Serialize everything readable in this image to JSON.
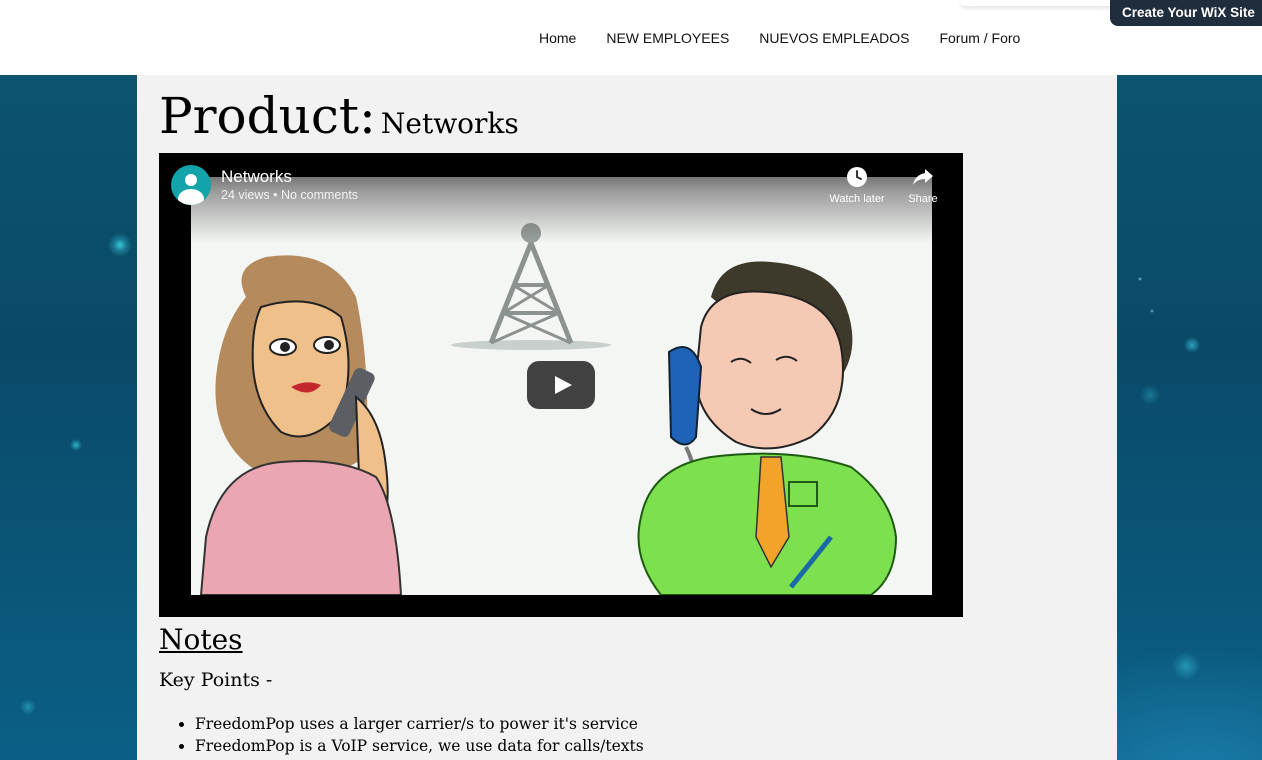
{
  "nav": {
    "items": [
      "Home",
      "NEW EMPLOYEES",
      "NUEVOS EMPLEADOS",
      "Forum / Foro"
    ]
  },
  "wix_banner": {
    "label": "Create Your WiX Site"
  },
  "page": {
    "title_prefix": "Product:",
    "title_name": "Networks"
  },
  "video": {
    "title": "Networks",
    "meta": "24 views • No comments",
    "watch_later_label": "Watch later",
    "share_label": "Share",
    "play_icon": "play-icon"
  },
  "notes": {
    "heading": "Notes",
    "subheading": "Key Points -",
    "bullets": [
      "FreedomPop uses a larger carrier/s to power it's service",
      "FreedomPop is a VoIP service, we use data for calls/texts"
    ]
  },
  "colors": {
    "content_bg": "#f2f2f2",
    "page_bg": "#0b5474",
    "wix_banner_bg": "#1f2d3d",
    "avatar": "#12a4a8"
  }
}
